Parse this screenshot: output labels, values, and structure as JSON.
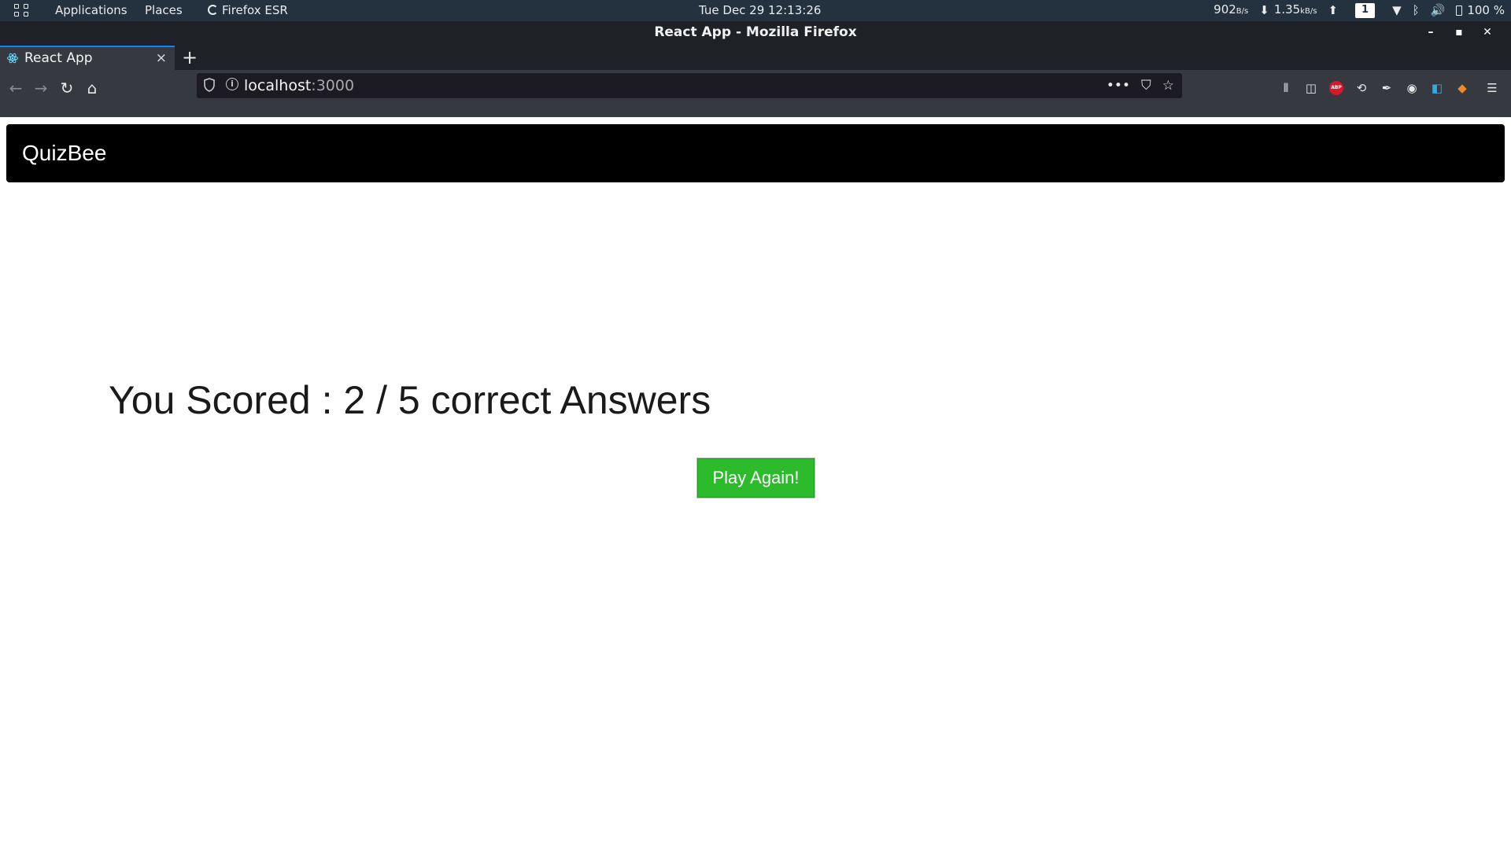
{
  "system_bar": {
    "applications": "Applications",
    "places": "Places",
    "firefox": "Firefox ESR",
    "datetime": "Tue Dec 29  12:13:26",
    "net_down_value": "902",
    "net_down_unit": "B/s",
    "net_up_value": "1.35",
    "net_up_unit": "kB/s",
    "workspace": "1",
    "battery": "100 %"
  },
  "window": {
    "title": "React App - Mozilla Firefox"
  },
  "tab": {
    "title": "React App",
    "close": "×",
    "new_tab": "+"
  },
  "address_bar": {
    "host": "localhost",
    "port": ":3000",
    "more": "•••"
  },
  "app": {
    "brand": "QuizBee",
    "score_text": "You Scored : 2 / 5 correct Answers",
    "play_again": "Play Again!"
  },
  "colors": {
    "system_bar_bg": "#24323f",
    "browser_chrome": "#36393f",
    "app_navbar_bg": "#000000",
    "button_green": "#2bbb2b"
  }
}
